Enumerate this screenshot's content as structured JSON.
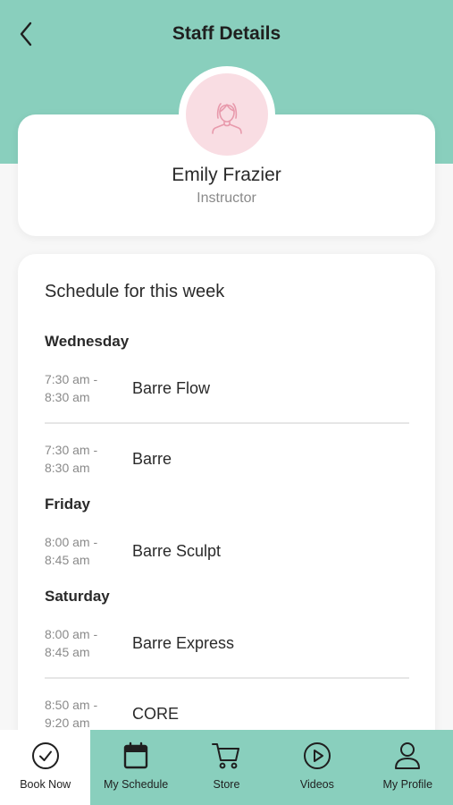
{
  "header": {
    "title": "Staff Details",
    "accent_color": "#89cfbd"
  },
  "profile": {
    "name": "Emily Frazier",
    "role": "Instructor",
    "avatar_icon": "person-icon",
    "avatar_bg": "#f9dde3"
  },
  "schedule": {
    "title": "Schedule for this week",
    "days": [
      {
        "day": "Wednesday",
        "sessions": [
          {
            "time": "7:30 am -",
            "time_end": "8:30 am",
            "class": "Barre Flow"
          },
          {
            "time": "7:30 am -",
            "time_end": "8:30 am",
            "class": "Barre"
          }
        ]
      },
      {
        "day": "Friday",
        "sessions": [
          {
            "time": "8:00 am -",
            "time_end": "8:45 am",
            "class": "Barre Sculpt"
          }
        ]
      },
      {
        "day": "Saturday",
        "sessions": [
          {
            "time": "8:00 am -",
            "time_end": "8:45 am",
            "class": "Barre Express"
          },
          {
            "time": "8:50 am -",
            "time_end": "9:20 am",
            "class": "CORE"
          }
        ]
      }
    ]
  },
  "nav": {
    "items": [
      {
        "label": "Book Now",
        "icon": "check-circle-icon",
        "active": true
      },
      {
        "label": "My Schedule",
        "icon": "calendar-icon",
        "active": false
      },
      {
        "label": "Store",
        "icon": "cart-icon",
        "active": false
      },
      {
        "label": "Videos",
        "icon": "play-circle-icon",
        "active": false
      },
      {
        "label": "My Profile",
        "icon": "user-icon",
        "active": false
      }
    ]
  }
}
